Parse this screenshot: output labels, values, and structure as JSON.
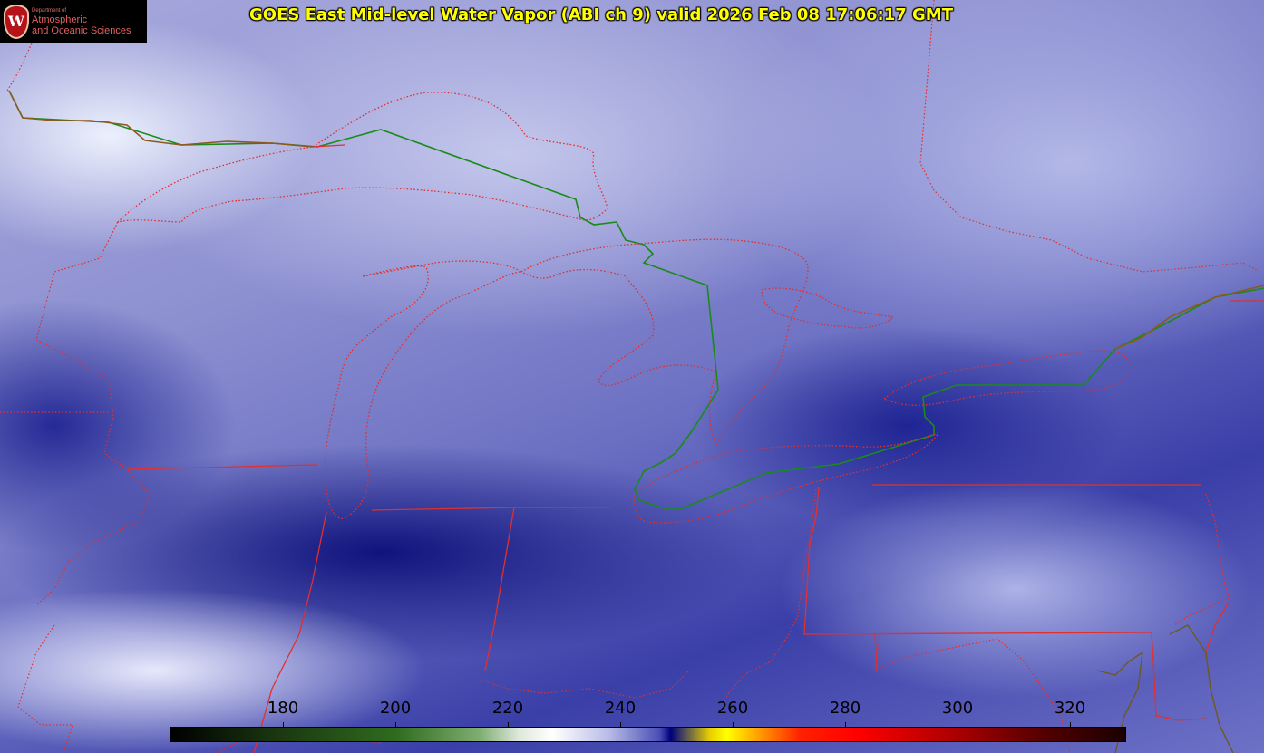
{
  "title": "GOES East Mid-level Water Vapor (ABI ch 9)  valid 2026 Feb 08 17:06:17 GMT",
  "logo": {
    "dept": "Department of",
    "line1": "Atmospheric",
    "line2": "and Oceanic Sciences",
    "crest_letter": "W"
  },
  "colorbar": {
    "min": 160,
    "max": 330,
    "ticks": [
      "180",
      "200",
      "220",
      "240",
      "260",
      "280",
      "300",
      "320"
    ],
    "tick_values": [
      180,
      200,
      220,
      240,
      260,
      280,
      300,
      320
    ],
    "stops": [
      {
        "v": 160,
        "c": "#000000"
      },
      {
        "v": 180,
        "c": "#1c3a10"
      },
      {
        "v": 200,
        "c": "#2f6b1e"
      },
      {
        "v": 215,
        "c": "#7fae72"
      },
      {
        "v": 222,
        "c": "#dfe8dc"
      },
      {
        "v": 228,
        "c": "#ffffff"
      },
      {
        "v": 238,
        "c": "#b8bce6"
      },
      {
        "v": 247,
        "c": "#4a4fb5"
      },
      {
        "v": 249,
        "c": "#00007a"
      },
      {
        "v": 251,
        "c": "#404060"
      },
      {
        "v": 256,
        "c": "#e8d000"
      },
      {
        "v": 259,
        "c": "#ffff00"
      },
      {
        "v": 265,
        "c": "#ff9900"
      },
      {
        "v": 272,
        "c": "#ff2200"
      },
      {
        "v": 282,
        "c": "#ff0000"
      },
      {
        "v": 300,
        "c": "#aa0000"
      },
      {
        "v": 315,
        "c": "#550000"
      },
      {
        "v": 330,
        "c": "#1a0000"
      }
    ]
  },
  "colors": {
    "title": "#ffff00",
    "state_borders": "#e03030",
    "intl_border": "#1a8a1a",
    "coastline": "#8a5a20"
  }
}
